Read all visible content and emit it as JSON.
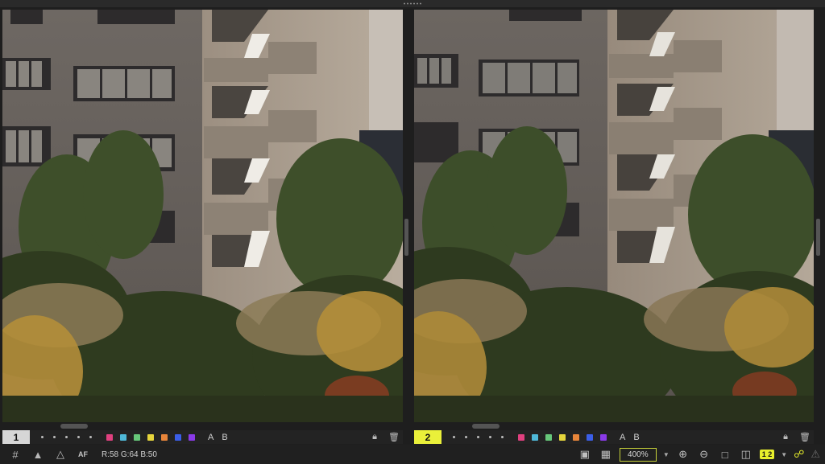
{
  "viewers": [
    {
      "index_label": "1",
      "active": false
    },
    {
      "index_label": "2",
      "active": true
    }
  ],
  "rating": {
    "label_a": "A",
    "label_b": "B",
    "color_labels": [
      "#e0407f",
      "#4fb8d8",
      "#67c77a",
      "#e6d53c",
      "#e8853a",
      "#3b5ee8",
      "#8a3ae8"
    ]
  },
  "status": {
    "rgb_readout": "R:58 G:64 B:50",
    "af_label": "AF",
    "zoom_level": "400%",
    "compare_label": "1 2"
  },
  "icons": {
    "lock": "lock-icon",
    "trash": "trash-icon",
    "grid": "grid-icon",
    "warning": "warning-icon"
  }
}
